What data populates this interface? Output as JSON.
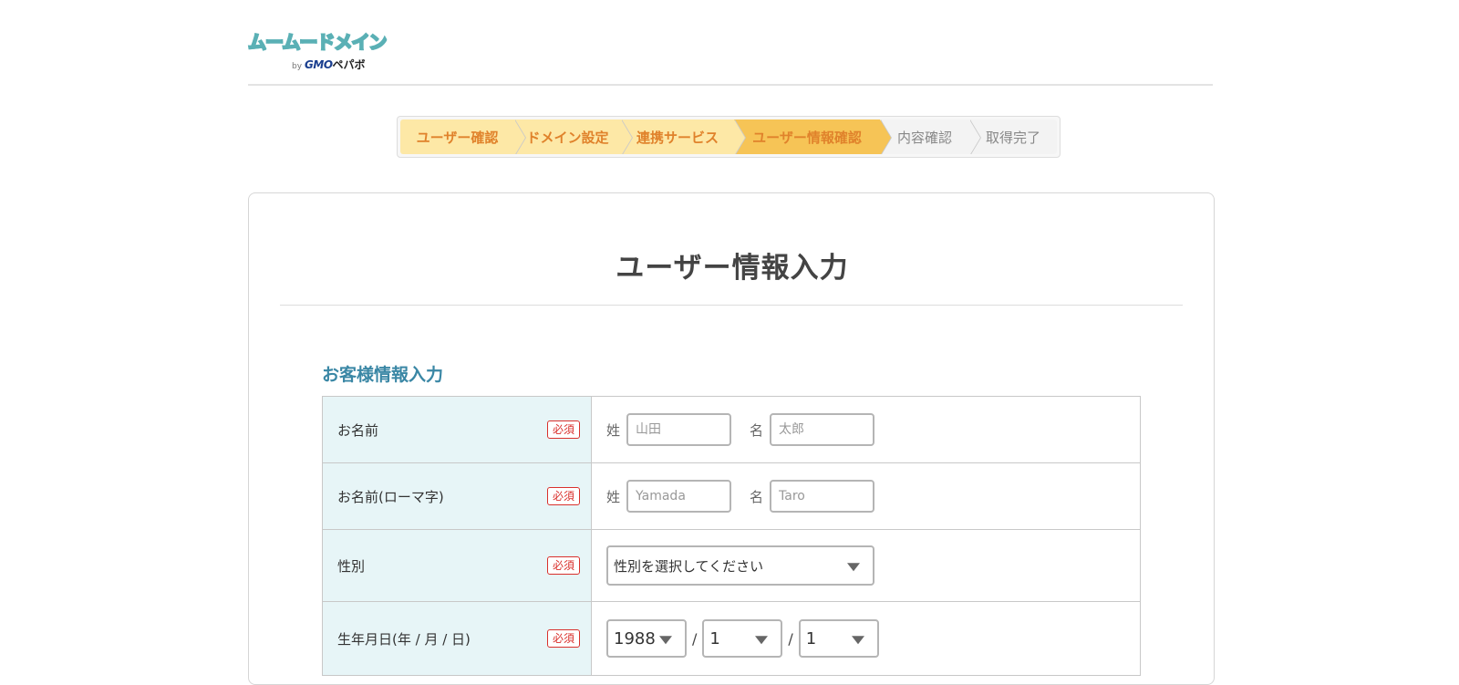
{
  "header": {
    "logo_text": "ムームードメイン",
    "logo_by": "by",
    "logo_brand": "GMO",
    "logo_brand_sub": "ペパボ"
  },
  "stepper": {
    "steps": [
      {
        "label": "ユーザー確認",
        "state": "done"
      },
      {
        "label": "ドメイン設定",
        "state": "done"
      },
      {
        "label": "連携サービス",
        "state": "done"
      },
      {
        "label": "ユーザー情報確認",
        "state": "active"
      },
      {
        "label": "内容確認",
        "state": "todo"
      },
      {
        "label": "取得完了",
        "state": "todo"
      }
    ]
  },
  "page": {
    "title": "ユーザー情報入力",
    "section_title": "お客様情報入力"
  },
  "form": {
    "required_badge": "必須",
    "name": {
      "label": "お名前",
      "last_label": "姓",
      "last_placeholder": "山田",
      "first_label": "名",
      "first_placeholder": "太郎"
    },
    "name_roman": {
      "label": "お名前(ローマ字)",
      "last_label": "姓",
      "last_placeholder": "Yamada",
      "first_label": "名",
      "first_placeholder": "Taro"
    },
    "gender": {
      "label": "性別",
      "selected": "性別を選択してください"
    },
    "birthday": {
      "label": "生年月日(年 / 月 / 日)",
      "year": "1988",
      "month": "1",
      "day": "1",
      "separator": "/"
    }
  },
  "colors": {
    "step_done": "#fde8a6",
    "step_active": "#f6c456",
    "step_text": "#e0822b",
    "section_title": "#3a87a5",
    "label_bg": "#e7f5f7",
    "required": "#d9302c"
  }
}
